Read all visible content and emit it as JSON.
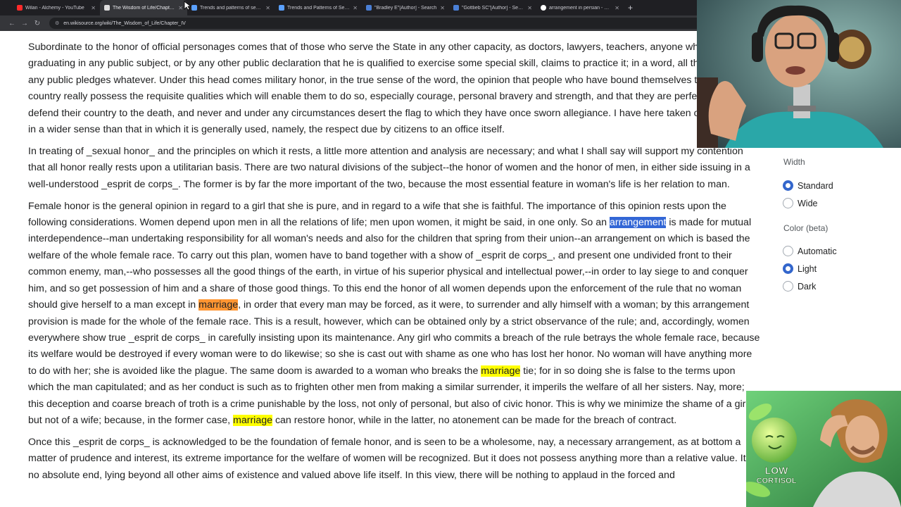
{
  "browser": {
    "tabs": [
      {
        "title": "Wilan - Alchemy - YouTube",
        "color": "#ff2a2a",
        "active": false
      },
      {
        "title": "The Wisdom of Life/Chapter IV",
        "color": "#dddddd",
        "active": true
      },
      {
        "title": "Trends and patterns of sexual",
        "color": "#5aa0ff",
        "active": false
      },
      {
        "title": "Trends and Patterns of Sexual",
        "color": "#5aa0ff",
        "active": false
      },
      {
        "title": "\"Bradley E\"[Author] - Search",
        "color": "#4a7fd6",
        "active": false
      },
      {
        "title": "\"Gottlieb SC\"[Author] - Search",
        "color": "#4a7fd6",
        "active": false
      },
      {
        "title": "arrangement in persian - Goog",
        "color": "#ffffff",
        "active": false
      }
    ],
    "new_tab": "+",
    "url": "en.wikisource.org/wiki/The_Wisdom_of_Life/Chapter_IV"
  },
  "content": {
    "p1": "Subordinate to the honor of official personages comes that of those who serve the State in any other capacity, as doctors, lawyers, teachers, anyone who, by graduating in any public subject, or by any other public declaration that he is qualified to exercise some special skill, claims to practice it; in a word, all those who take any public pledges whatever. Under this head comes military honor, in the true sense of the word, the opinion that people who have bound themselves to defend their country really possess the requisite qualities which will enable them to do so, especially courage, personal bravery and strength, and that they are perfectly ready to defend their country to the death, and never and under any circumstances desert the flag to which they have once sworn allegiance. I have here taken official honor in a wider sense than that in which it is generally used, namely, the respect due by citizens to an office itself.",
    "p2": "In treating of _sexual honor_ and the principles on which it rests, a little more attention and analysis are necessary; and what I shall say will support my contention that all honor really rests upon a utilitarian basis. There are two natural divisions of the subject--the honor of women and the honor of men, in either side issuing in a well-understood _esprit de corps_. The former is by far the more important of the two, because the most essential feature in woman's life is her relation to man.",
    "p3a": "Female honor is the general opinion in regard to a girl that she is pure, and in regard to a wife that she is faithful. The importance of this opinion rests upon the following considerations. Women depend upon men in all the relations of life; men upon women, it might be said, in one only. So an ",
    "p3_hl1": "arrangement",
    "p3b": " is made for mutual interdependence--man undertaking responsibility for all woman's needs and also for the children that spring from their union--an arrangement on which is based the welfare of the whole female race. To carry out this plan, women have to band together with a show of _esprit de corps_, and present one undivided front to their common enemy, man,--who possesses all the good things of the earth, in virtue of his superior physical and intellectual power,--in order to lay siege to and conquer him, and so get possession of him and a share of those good things. To this end the honor of all women depends upon the enforcement of the rule that no woman should give herself to a man except in ",
    "p3_hl2": "marriage",
    "p3c": ", in order that every man may be forced, as it were, to surrender and ally himself with a woman; by this arrangement provision is made for the whole of the female race. This is a result, however, which can be obtained only by a strict observance of the rule; and, accordingly, women everywhere show true _esprit de corps_ in carefully insisting upon its maintenance. Any girl who commits a breach of the rule betrays the whole female race, because its welfare would be destroyed if every woman were to do likewise; so she is cast out with shame as one who has lost her honor. No woman will have anything more to do with her; she is avoided like the plague. The same doom is awarded to a woman who breaks the ",
    "p3_hl3": "marriage",
    "p3d": " tie; for in so doing she is false to the terms upon which the man capitulated; and as her conduct is such as to frighten other men from making a similar surrender, it imperils the welfare of all her sisters. Nay, more; this deception and coarse breach of troth is a crime punishable by the loss, not only of personal, but also of civic honor. This is why we minimize the shame of a girl, but not of a wife; because, in the former case, ",
    "p3_hl4": "marriage",
    "p3e": " can restore honor, while in the latter, no atonement can be made for the breach of contract.",
    "p4": "Once this _esprit de corps_ is acknowledged to be the foundation of female honor, and is seen to be a wholesome, nay, a necessary arrangement, as at bottom a matter of prudence and interest, its extreme importance for the welfare of women will be recognized. But it does not possess anything more than a relative value. It is no absolute end, lying beyond all other aims of existence and valued above life itself. In this view, there will be nothing to applaud in the forced and"
  },
  "appearance": {
    "width_heading": "Width",
    "width_options": [
      "Standard",
      "Wide"
    ],
    "width_selected": "Standard",
    "color_heading": "Color (beta)",
    "color_options": [
      "Automatic",
      "Light",
      "Dark"
    ],
    "color_selected": "Light"
  },
  "thumbnail": {
    "line1": "LOW",
    "line2": "CORTISOL"
  }
}
